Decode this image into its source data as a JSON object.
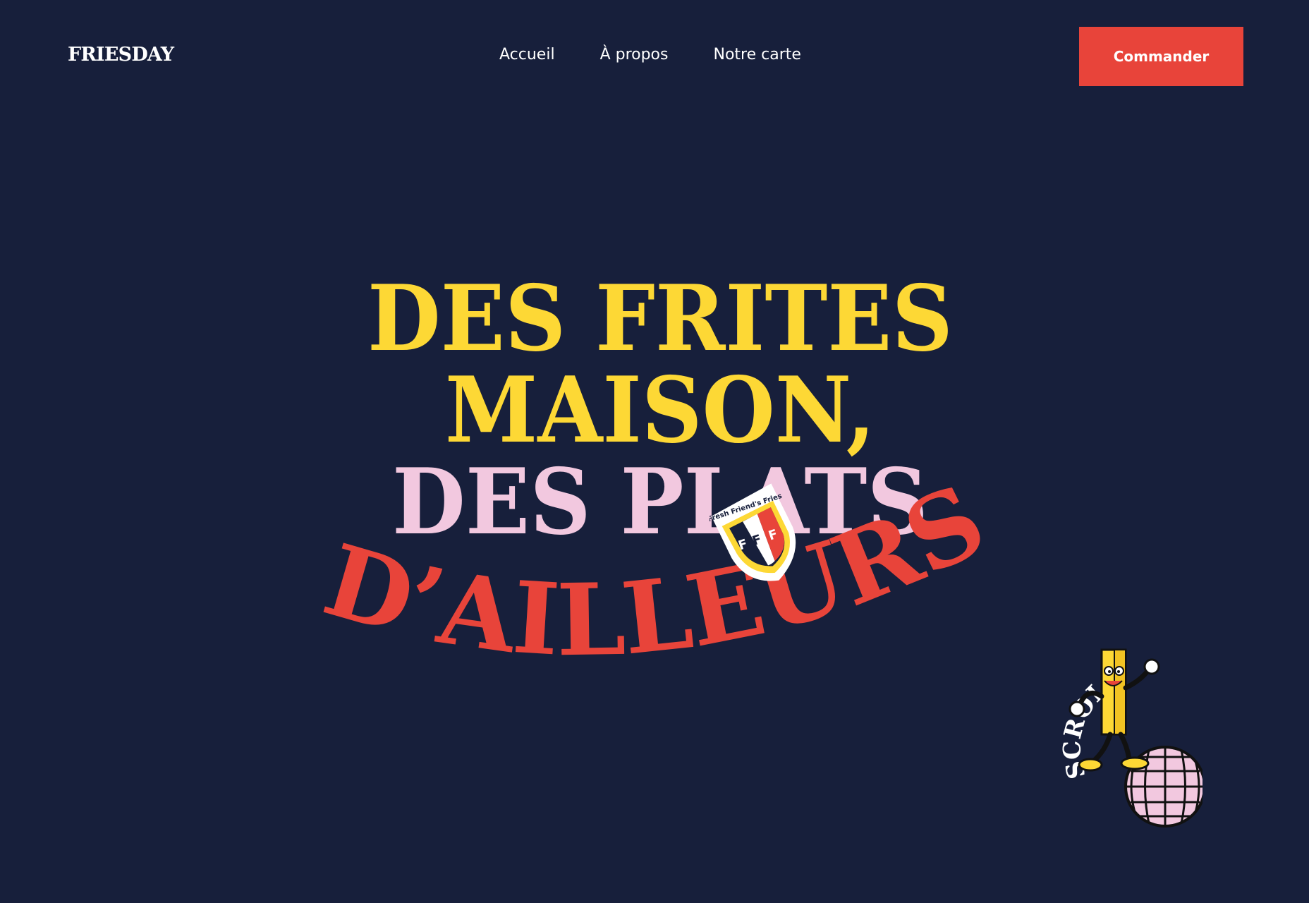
{
  "brand": {
    "name": "FRIESDAY"
  },
  "nav": {
    "items": [
      {
        "label": "Accueil"
      },
      {
        "label": "À propos"
      },
      {
        "label": "Notre carte"
      }
    ],
    "cta_label": "Commander"
  },
  "hero": {
    "headline": {
      "line1": "DES FRITES",
      "line2": "MAISON,",
      "line3": "DES PLATS",
      "line4": "D’AILLEURS"
    }
  },
  "badge": {
    "text": "Fresh Friend's Fries",
    "letters": [
      "F",
      "F",
      "F"
    ]
  },
  "mascot": {
    "label": "SCROLL",
    "icon": "fry-mascot-on-disco-ball"
  },
  "colors": {
    "background": "#171f3b",
    "yellow": "#fdd835",
    "pink": "#f2c8df",
    "red": "#e8443a",
    "white": "#ffffff"
  }
}
